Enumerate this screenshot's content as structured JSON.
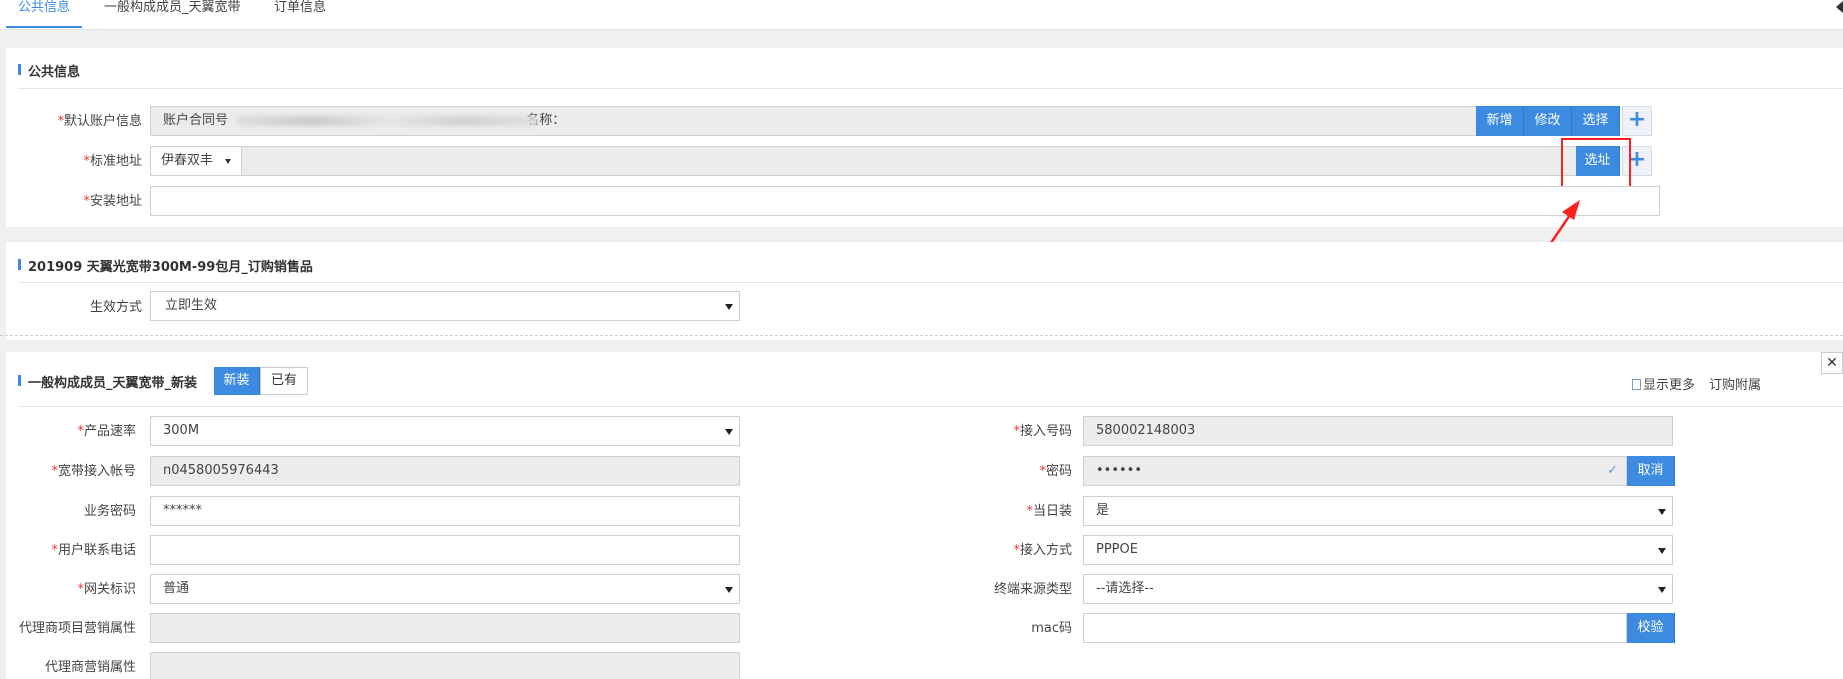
{
  "tabs": [
    {
      "label": "公共信息",
      "active": true
    },
    {
      "label": "一般构成成员_天翼宽带",
      "active": false
    },
    {
      "label": "订单信息",
      "active": false
    }
  ],
  "public_info": {
    "title": "公共信息",
    "account_label": "默认账户信息",
    "account_value": "账户合同号",
    "account_value_tail": "名称：",
    "account_buttons": {
      "add": "新增",
      "edit": "修改",
      "select": "选择"
    },
    "address_label": "标准地址",
    "address_city": "伊春双丰",
    "address_select_btn": "选址",
    "install_label": "安装地址",
    "install_value": ""
  },
  "product": {
    "title": "201909 天翼光宽带300M-99包月_订购销售品",
    "effect_label": "生效方式",
    "effect_value": "立即生效"
  },
  "member": {
    "title": "一般构成成员_天翼宽带_新装",
    "toggle_new": "新装",
    "toggle_existing": "已有",
    "show_more": "显示更多",
    "order_attach": "订购附属",
    "left_fields": [
      {
        "label": "产品速率",
        "required": true,
        "value": "300M",
        "type": "select"
      },
      {
        "label": "宽带接入帐号",
        "required": true,
        "value": "n0458005976443",
        "type": "readonly"
      },
      {
        "label": "业务密码",
        "required": false,
        "value": "******",
        "type": "input"
      },
      {
        "label": "用户联系电话",
        "required": true,
        "value": "",
        "type": "input"
      },
      {
        "label": "网关标识",
        "required": true,
        "value": "普通",
        "type": "select"
      },
      {
        "label": "代理商项目营销属性",
        "required": false,
        "value": "",
        "type": "readonly"
      },
      {
        "label": "代理商营销属性",
        "required": false,
        "value": "",
        "type": "readonly"
      }
    ],
    "right_fields": [
      {
        "label": "接入号码",
        "required": true,
        "value": "580002148003",
        "type": "readonly"
      },
      {
        "label": "密码",
        "required": true,
        "value": "••••••",
        "type": "password",
        "button": "取消"
      },
      {
        "label": "当日装",
        "required": true,
        "value": "是",
        "type": "select"
      },
      {
        "label": "接入方式",
        "required": true,
        "value": "PPPOE",
        "type": "select"
      },
      {
        "label": "终端来源类型",
        "required": false,
        "value": "--请选择--",
        "type": "select"
      },
      {
        "label": "mac码",
        "required": false,
        "value": "",
        "type": "input",
        "button": "校验"
      }
    ]
  },
  "colors": {
    "accent": "#3c8be0",
    "required": "#e4393c",
    "highlight": "#ff2020"
  },
  "icons": [
    "collapse-left-icon",
    "plus-icon",
    "dropdown-caret-icon",
    "check-icon",
    "document-icon",
    "close-icon"
  ]
}
